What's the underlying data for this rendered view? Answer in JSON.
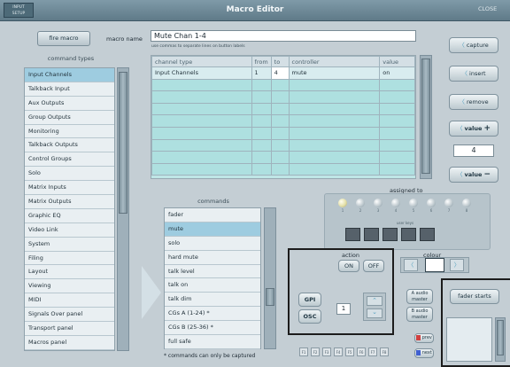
{
  "window": {
    "title": "Macro Editor",
    "left_badge": "INPUT\nSETUP",
    "right_label": "CLOSE"
  },
  "top": {
    "fire_macro": "fire macro",
    "macro_name_label": "macro name",
    "macro_name_value": "Mute Chan 1-4",
    "hint": "use commas to separate lines on button labels"
  },
  "command_types": {
    "header": "command types",
    "items": [
      "Input Channels",
      "Talkback Input",
      "Aux Outputs",
      "Group Outputs",
      "Monitoring",
      "Talkback Outputs",
      "Control Groups",
      "Solo",
      "Matrix Inputs",
      "Matrix Outputs",
      "Graphic EQ",
      "Video Link",
      "System",
      "Filing",
      "Layout",
      "Viewing",
      "MIDI",
      "Signals Over panel",
      "Transport panel",
      "Macros panel"
    ],
    "selected_index": 0
  },
  "macro_table": {
    "columns": [
      "channel type",
      "from",
      "to",
      "controller",
      "value"
    ],
    "rows": [
      [
        "Input Channels",
        "1",
        "4",
        "mute",
        "on"
      ]
    ],
    "empty_rows": 8
  },
  "commands": {
    "header": "commands",
    "items": [
      "fader",
      "mute",
      "solo",
      "hard mute",
      "talk level",
      "talk on",
      "talk dim",
      "CGs A (1-24) *",
      "CGs B (25-36) *",
      "full safe"
    ],
    "selected_index": 1,
    "footnote": "* commands can only be captured"
  },
  "right_buttons": {
    "capture": "capture",
    "insert": "insert",
    "remove": "remove",
    "value_plus": "value",
    "value_display": "4",
    "value_minus": "value",
    "plus_sign": "+",
    "minus_sign": "−"
  },
  "assigned_to": {
    "label": "assigned to",
    "dots": [
      "1",
      "2",
      "3",
      "4",
      "5",
      "6",
      "7",
      "8"
    ],
    "user_keys_label": "user keys"
  },
  "action": {
    "label": "action",
    "on": "ON",
    "off": "OFF"
  },
  "colour": {
    "label": "colour"
  },
  "trigger": {
    "gpi": "GPI",
    "osc": "OSC",
    "number": "1"
  },
  "audio_master": {
    "a": "A audio\nmaster",
    "b": "B audio\nmaster",
    "prev": "prev",
    "next": "next",
    "fader_starts": "fader starts"
  },
  "bottom_keys": [
    "F1",
    "F2",
    "F3",
    "F4",
    "F5",
    "F6",
    "F7",
    "F8"
  ]
}
